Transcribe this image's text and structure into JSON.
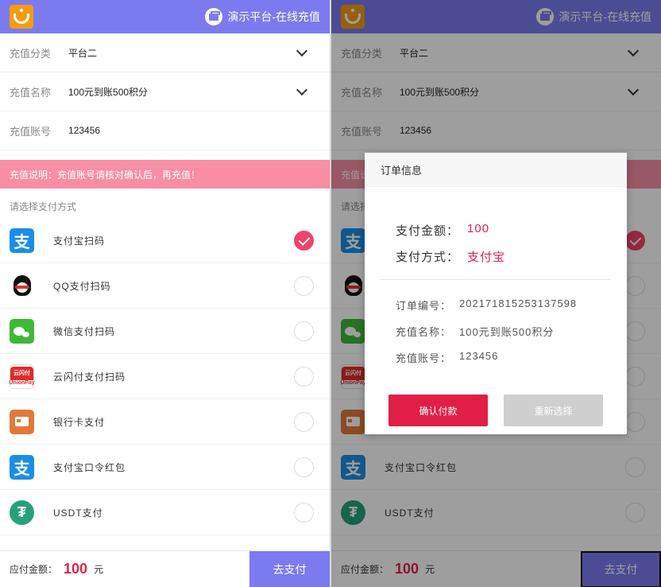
{
  "header": {
    "title": "演示平台-在线充值"
  },
  "form": {
    "category": {
      "label": "充值分类",
      "value": "平台二"
    },
    "product": {
      "label": "充值名称",
      "value": "100元到账500积分"
    },
    "account": {
      "label": "充值账号",
      "value": "123456"
    }
  },
  "notice": "充值说明：充值账号请核对确认后，再充值！",
  "methods_title": "请选择支付方式",
  "methods": [
    {
      "label": "支付宝扫码",
      "icon": "alipay-icon",
      "selected": true
    },
    {
      "label": "QQ支付扫码",
      "icon": "qq-icon",
      "selected": false
    },
    {
      "label": "微信支付扫码",
      "icon": "wechat-icon",
      "selected": false
    },
    {
      "label": "云闪付支付扫码",
      "icon": "unionpay-icon",
      "selected": false
    },
    {
      "label": "银行卡支付",
      "icon": "bank-card-icon",
      "selected": false
    },
    {
      "label": "支付宝口令红包",
      "icon": "alipay-icon",
      "selected": false
    },
    {
      "label": "USDT支付",
      "icon": "usdt-icon",
      "selected": false
    }
  ],
  "footer": {
    "due_label": "应付金额：",
    "amount": "100",
    "unit": "元",
    "pay_label": "去支付"
  },
  "modal": {
    "title": "订单信息",
    "amount_label": "支付金额：",
    "amount_value": "100",
    "method_label": "支付方式：",
    "method_value": "支付宝",
    "order_label": "订单编号：",
    "order_value": "20217181525313759​8",
    "product_label": "充值名称：",
    "product_value": "100元到账500积分",
    "account_label": "充值账号：",
    "account_value": "123456",
    "confirm_label": "确认付款",
    "reselect_label": "重新选择"
  },
  "icon_glyphs": {
    "alipay": "支",
    "unionpay_top": "云闪付",
    "unionpay_bottom": "UnionPay",
    "usdt": "₮"
  },
  "colors": {
    "accent": "#7b7bef",
    "notice": "#f78ea4",
    "danger": "#e01f47",
    "selected": "#f0436a"
  }
}
